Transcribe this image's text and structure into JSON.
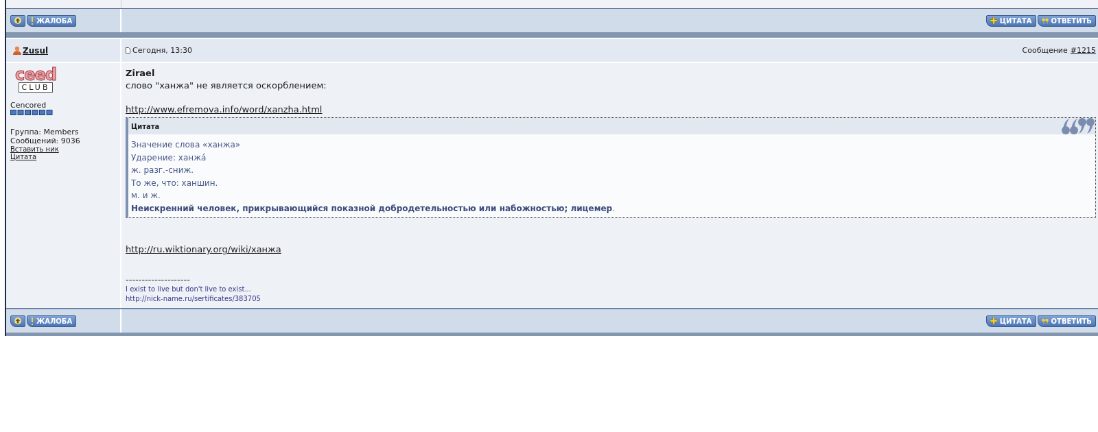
{
  "bars": [
    {
      "left_buttons": [
        {
          "kind": "up"
        },
        {
          "kind": "report",
          "label": "ЖАЛОБА"
        }
      ],
      "right_buttons": [
        {
          "kind": "quote",
          "label": "ЦИТАТА"
        },
        {
          "kind": "reply",
          "label": "ОТВЕТИТЬ"
        }
      ]
    },
    {
      "left_buttons": [
        {
          "kind": "up"
        },
        {
          "kind": "report",
          "label": "ЖАЛОБА"
        }
      ],
      "right_buttons": [
        {
          "kind": "quote",
          "label": "ЦИТАТА"
        },
        {
          "kind": "reply",
          "label": "ОТВЕТИТЬ"
        }
      ]
    }
  ],
  "post": {
    "author": "Zusul",
    "date": "Сегодня, 13:30",
    "message_label": "Сообщение",
    "message_link": "#1215",
    "logo": {
      "top": "ceed",
      "bottom": "CLUB"
    },
    "rank": "Cencored",
    "group": "Группа: Members",
    "posts": "Сообщений: 9036",
    "links": [
      "Вставить ник",
      "Цитата"
    ],
    "body": {
      "addressee": "Zirael",
      "text": "слово \"ханжа\" не является оскорблением:",
      "link_1": "http://www.efremova.info/word/xanzha.html",
      "quote": {
        "title": "Цитата",
        "lines": [
          "Значение слова «ханжа»",
          "Ударение: ханжа́",
          "ж. разг.-сниж.",
          "То же, что: ханшин.",
          "м. и ж.",
          "**Неискренний человек, прикрывающийся показной добродетельностью или набожностью; лицемер**."
        ]
      },
      "link_2": "http://ru.wiktionary.org/wiki/ханжа",
      "signature": {
        "separator": "--------------------",
        "lines": [
          "I exist to live but don't live to exist...",
          "http://nick-name.ru/sertificates/383705"
        ]
      }
    }
  }
}
